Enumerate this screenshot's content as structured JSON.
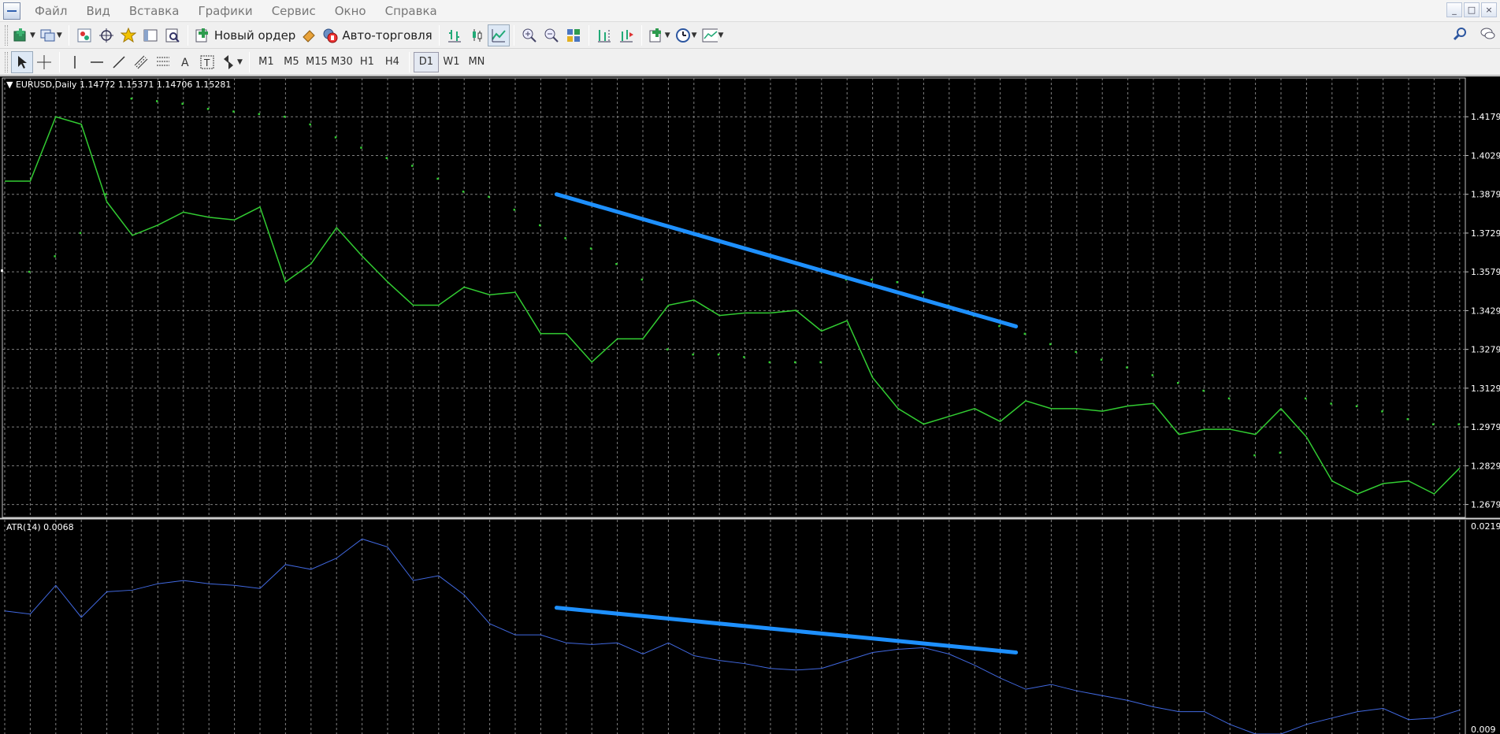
{
  "menu": {
    "items": [
      "Файл",
      "Вид",
      "Вставка",
      "Графики",
      "Сервис",
      "Окно",
      "Справка"
    ]
  },
  "toolbar": {
    "new_order_label": "Новый ордер",
    "auto_trading_label": "Авто-торговля",
    "timeframes": [
      "M1",
      "M5",
      "M15",
      "M30",
      "H1",
      "H4",
      "D1",
      "W1",
      "MN"
    ]
  },
  "window_buttons": [
    "_",
    "□",
    "×"
  ],
  "icons": {
    "new_chart": "new-chart-icon",
    "profiles": "profiles-icon",
    "market_watch": "market-watch-icon",
    "navigator": "navigator-icon",
    "favorites": "favorites-icon",
    "terminal": "terminal-icon",
    "tester": "tester-icon",
    "new_order": "new-order-icon",
    "meta_editor": "meta-editor-icon",
    "auto_trading": "auto-trading-icon",
    "bar_chart": "bar-chart-icon",
    "candle_chart": "candle-chart-icon",
    "line_chart": "line-chart-icon",
    "zoom_in": "zoom-in-icon",
    "zoom_out": "zoom-out-icon",
    "tile_windows": "tile-windows-icon",
    "chart_shift": "chart-shift-icon",
    "autoscroll": "autoscroll-icon",
    "indicators": "indicators-icon",
    "periods": "periods-icon",
    "templates": "templates-icon",
    "search": "search-icon",
    "chat": "chat-icon",
    "cursor": "cursor-icon",
    "crosshair": "crosshair-icon",
    "vertical_line": "vertical-line-icon",
    "horizontal_line": "horizontal-line-icon",
    "trendline": "trendline-icon",
    "equidistant_channel": "equidistant-channel-icon",
    "fibonacci": "fibonacci-icon",
    "text": "text-icon",
    "text_label": "text-label-icon",
    "arrows": "arrows-icon"
  },
  "colors": {
    "chart_bg": "#000000",
    "grid": "#7f7f7f",
    "price_line": "#32cd32",
    "parabolic_sar": "#32cd32",
    "atr_line": "#4169e1",
    "trendline": "#1e90ff",
    "axis_text": "#ffffff"
  },
  "chart_header": "EURUSD,Daily  1.14772 1.15371 1.14706 1.15281",
  "atr_header": "ATR(14) 0.0068",
  "chart_data": [
    {
      "type": "line",
      "symbol": "EURUSD",
      "timeframe": "Daily",
      "ohlc_header": [
        1.14772,
        1.15371,
        1.14706,
        1.15281
      ],
      "y_ticks": [
        "1.4179",
        "1.4029",
        "1.3879",
        "1.3729",
        "1.3579",
        "1.3429",
        "1.3279",
        "1.3129",
        "1.2979",
        "1.2829",
        "1.2679"
      ],
      "ylim": [
        1.2629,
        1.4329
      ],
      "series": [
        {
          "values": [
            1.393,
            1.393,
            1.4179,
            1.415,
            1.385,
            1.372,
            1.376,
            1.381,
            1.379,
            1.378,
            1.383,
            1.354,
            1.361,
            1.375,
            1.364,
            1.354,
            1.345,
            1.345,
            1.352,
            1.349,
            1.35,
            1.334,
            1.334,
            1.323,
            1.332,
            1.332,
            1.345,
            1.347,
            1.341,
            1.342,
            1.342,
            1.343,
            1.335,
            1.339,
            1.317,
            1.305,
            1.299,
            1.302,
            1.305,
            1.3,
            1.308,
            1.305,
            1.305,
            1.304,
            1.306,
            1.307,
            1.295,
            1.297,
            1.297,
            1.295,
            1.305,
            1.294,
            1.277,
            1.272,
            1.276,
            1.277,
            1.272,
            1.282
          ]
        },
        {
          "values": [
            1.358,
            1.364,
            1.373,
            1.388,
            1.425,
            1.424,
            1.423,
            1.421,
            1.42,
            1.419,
            1.418,
            1.415,
            1.41,
            1.406,
            1.402,
            1.399,
            1.394,
            1.389,
            1.387,
            1.382,
            1.376,
            1.371,
            1.367,
            1.361,
            1.355,
            1.328,
            1.326,
            1.326,
            1.325,
            1.323,
            1.323,
            1.323,
            1.355,
            1.355,
            1.354,
            1.35,
            1.345,
            1.341,
            1.337,
            1.334,
            1.33,
            1.327,
            1.324,
            1.321,
            1.318,
            1.315,
            1.312,
            1.309,
            1.287,
            1.288,
            1.309,
            1.307,
            1.306,
            1.304,
            1.301,
            1.299,
            1.299
          ]
        }
      ],
      "trendline": {
        "start": [
          21,
          1.3879
        ],
        "end": [
          39,
          1.3368
        ]
      }
    },
    {
      "type": "line",
      "indicator": "ATR(14)",
      "current_value": 0.0068,
      "y_ticks": [
        "0.0219",
        "0.009"
      ],
      "ylim": [
        0.0087,
        0.0221
      ],
      "series": [
        {
          "values": [
            0.0164,
            0.0162,
            0.018,
            0.016,
            0.0176,
            0.0177,
            0.0181,
            0.0183,
            0.0181,
            0.018,
            0.0178,
            0.0193,
            0.019,
            0.0197,
            0.0209,
            0.0204,
            0.0183,
            0.0186,
            0.0174,
            0.0156,
            0.0149,
            0.0149,
            0.0144,
            0.0143,
            0.0144,
            0.0137,
            0.0144,
            0.0136,
            0.0133,
            0.0131,
            0.0128,
            0.0127,
            0.0128,
            0.0133,
            0.0138,
            0.014,
            0.0141,
            0.0137,
            0.013,
            0.0122,
            0.0115,
            0.0118,
            0.0114,
            0.0111,
            0.0108,
            0.0104,
            0.0101,
            0.0101,
            0.0093,
            0.0087,
            0.0087,
            0.0093,
            0.0097,
            0.0101,
            0.0103,
            0.0096,
            0.0097,
            0.0102
          ]
        }
      ],
      "trendline": {
        "start": [
          21,
          0.0166
        ],
        "end": [
          39,
          0.0138
        ]
      }
    }
  ]
}
